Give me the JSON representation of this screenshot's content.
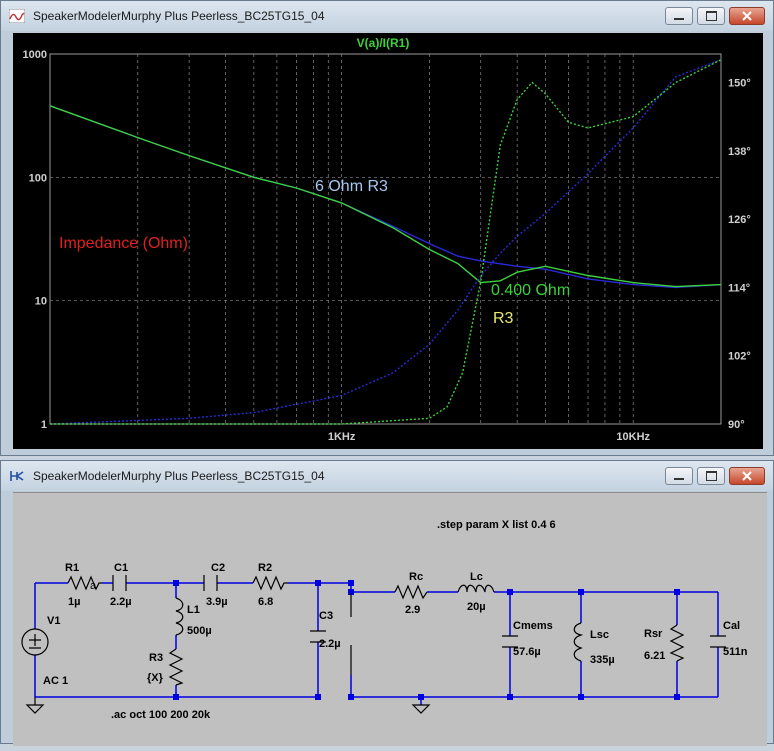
{
  "plot_window": {
    "title": "SpeakerModelerMurphy Plus Peerless_BC25TG15_04",
    "trace_title": "V(a)/I(R1)",
    "left_ticks": [
      "1000",
      "100",
      "10",
      "1"
    ],
    "right_ticks": [
      "150°",
      "138°",
      "126°",
      "114°",
      "102°",
      "90°"
    ],
    "x_ticks": [
      "1KHz",
      "10KHz"
    ],
    "annotations": {
      "impedance": "Impedance (Ohm)",
      "r3_6ohm": "6 Ohm R3",
      "r3_04ohm_line1": "0.400 Ohm",
      "r3_04ohm_line2": "R3"
    },
    "colors": {
      "background": "#000000",
      "blue": "#2a2ad8",
      "green": "#3cd23c",
      "red": "#e02020",
      "light_blue": "#a8c8f0",
      "yellow": "#e8e870"
    }
  },
  "chart_data": {
    "type": "line",
    "title": "V(a)/I(R1)",
    "x_scale": "log",
    "xlim": [
      100,
      20000
    ],
    "y_left_scale": "log",
    "y_left_lim": [
      1,
      1000
    ],
    "y_right_lim": [
      90,
      155
    ],
    "series": [
      {
        "name": "6 Ohm R3",
        "axis": "left",
        "x": [
          100,
          200,
          300,
          500,
          700,
          1000,
          1500,
          2000,
          2500,
          3000,
          4000,
          5000,
          7000,
          10000,
          14000,
          20000
        ],
        "values": [
          380,
          210,
          150,
          100,
          82,
          62,
          40,
          29,
          23,
          21,
          19,
          18,
          15,
          13.5,
          12.8,
          13.5
        ]
      },
      {
        "name": "0.400 Ohm R3",
        "axis": "left",
        "x": [
          100,
          200,
          300,
          500,
          700,
          1000,
          1500,
          2000,
          2500,
          3000,
          3500,
          4000,
          5000,
          7000,
          10000,
          14000,
          20000
        ],
        "values": [
          380,
          210,
          150,
          100,
          82,
          62,
          39,
          26,
          20,
          14,
          14.5,
          17,
          19,
          16,
          14,
          13,
          13.5
        ]
      },
      {
        "name": "6 Ohm R3 phase",
        "axis": "right",
        "x": [
          100,
          300,
          500,
          1000,
          1500,
          2000,
          2500,
          3000,
          3500,
          4000,
          5000,
          7000,
          10000,
          14000,
          20000
        ],
        "values": [
          90,
          91,
          92,
          95,
          99,
          104,
          110,
          116,
          120,
          123,
          127,
          134,
          142,
          151,
          154
        ]
      },
      {
        "name": "0.400 Ohm R3 phase",
        "axis": "right",
        "x": [
          100,
          1000,
          2000,
          2300,
          2600,
          3000,
          3500,
          4000,
          4500,
          5000,
          6000,
          7000,
          10000,
          14000,
          20000
        ],
        "values": [
          90,
          90,
          91,
          93,
          99,
          115,
          139,
          147,
          150,
          148,
          143,
          142,
          144,
          150,
          154
        ]
      }
    ]
  },
  "schematic_window": {
    "title": "SpeakerModelerMurphy Plus Peerless_BC25TG15_04",
    "directive_step": ".step param X list 0.4 6",
    "directive_ac": ".ac oct 100 200 20k",
    "source": {
      "name": "V1",
      "value": "AC 1"
    },
    "node_label": "a",
    "components": [
      {
        "name": "R1",
        "value": "1µ"
      },
      {
        "name": "C1",
        "value": "2.2µ"
      },
      {
        "name": "C2",
        "value": "3.9µ"
      },
      {
        "name": "R2",
        "value": "6.8"
      },
      {
        "name": "L1",
        "value": "500µ"
      },
      {
        "name": "R3",
        "value": "{X}"
      },
      {
        "name": "C3",
        "value": "2.2µ"
      },
      {
        "name": "Rc",
        "value": "2.9"
      },
      {
        "name": "Lc",
        "value": "20µ"
      },
      {
        "name": "Cmems",
        "value": "57.6µ"
      },
      {
        "name": "Lsc",
        "value": "335µ"
      },
      {
        "name": "Rsr",
        "value": "6.21"
      },
      {
        "name": "Cal",
        "value": "511n"
      }
    ]
  }
}
